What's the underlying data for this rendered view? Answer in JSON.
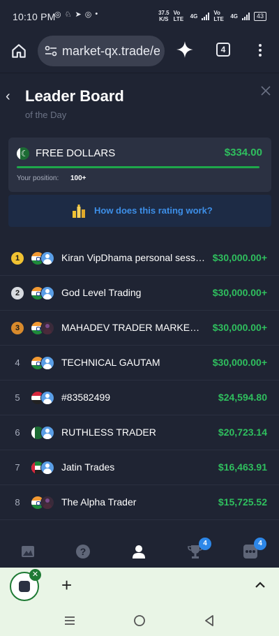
{
  "status_bar": {
    "time": "10:10 PM",
    "net_speed": "37.5",
    "net_unit": "K/S",
    "carrier1": "Vo LTE",
    "carrier1_net": "4G",
    "carrier2": "Vo LTE",
    "carrier2_net": "4G",
    "battery": "43"
  },
  "browser": {
    "url": "market-qx.trade/e",
    "tab_count": "4"
  },
  "page": {
    "title": "Leader Board",
    "subtitle": "of the Day"
  },
  "my_card": {
    "name": "FREE DOLLARS",
    "amount": "$334.00",
    "position_label": "Your position:",
    "position_value": "100+"
  },
  "info_link": "How does this rating work?",
  "leaders": [
    {
      "rank": "1",
      "medal": "gold",
      "flag": "in",
      "name": "Kiran VipDhama personal session",
      "amount": "$30,000.00+"
    },
    {
      "rank": "2",
      "medal": "silver",
      "flag": "in",
      "name": "God Level Trading",
      "amount": "$30,000.00+"
    },
    {
      "rank": "3",
      "medal": "bronze",
      "flag": "in",
      "name": "MAHADEV TRADER MARKET K BAAP",
      "amount": "$30,000.00+"
    },
    {
      "rank": "4",
      "medal": "",
      "flag": "in",
      "name": "TECHNICAL GAUTAM",
      "amount": "$30,000.00+"
    },
    {
      "rank": "5",
      "medal": "",
      "flag": "iq",
      "name": "#83582499",
      "amount": "$24,594.80"
    },
    {
      "rank": "6",
      "medal": "",
      "flag": "pk",
      "name": "RUTHLESS TRADER",
      "amount": "$20,723.14"
    },
    {
      "rank": "7",
      "medal": "",
      "flag": "ae",
      "name": "Jatin Trades",
      "amount": "$16,463.91"
    },
    {
      "rank": "8",
      "medal": "",
      "flag": "in",
      "name": "The Alpha Trader",
      "amount": "$15,725.52"
    }
  ],
  "bottom_nav": {
    "trophy_badge": "4",
    "more_badge": "4"
  },
  "colors": {
    "background": "#1f2433",
    "card": "#2b3142",
    "accent_green": "#2fbf5e",
    "link_blue": "#3d8fe8",
    "badge_blue": "#2d87e8"
  }
}
